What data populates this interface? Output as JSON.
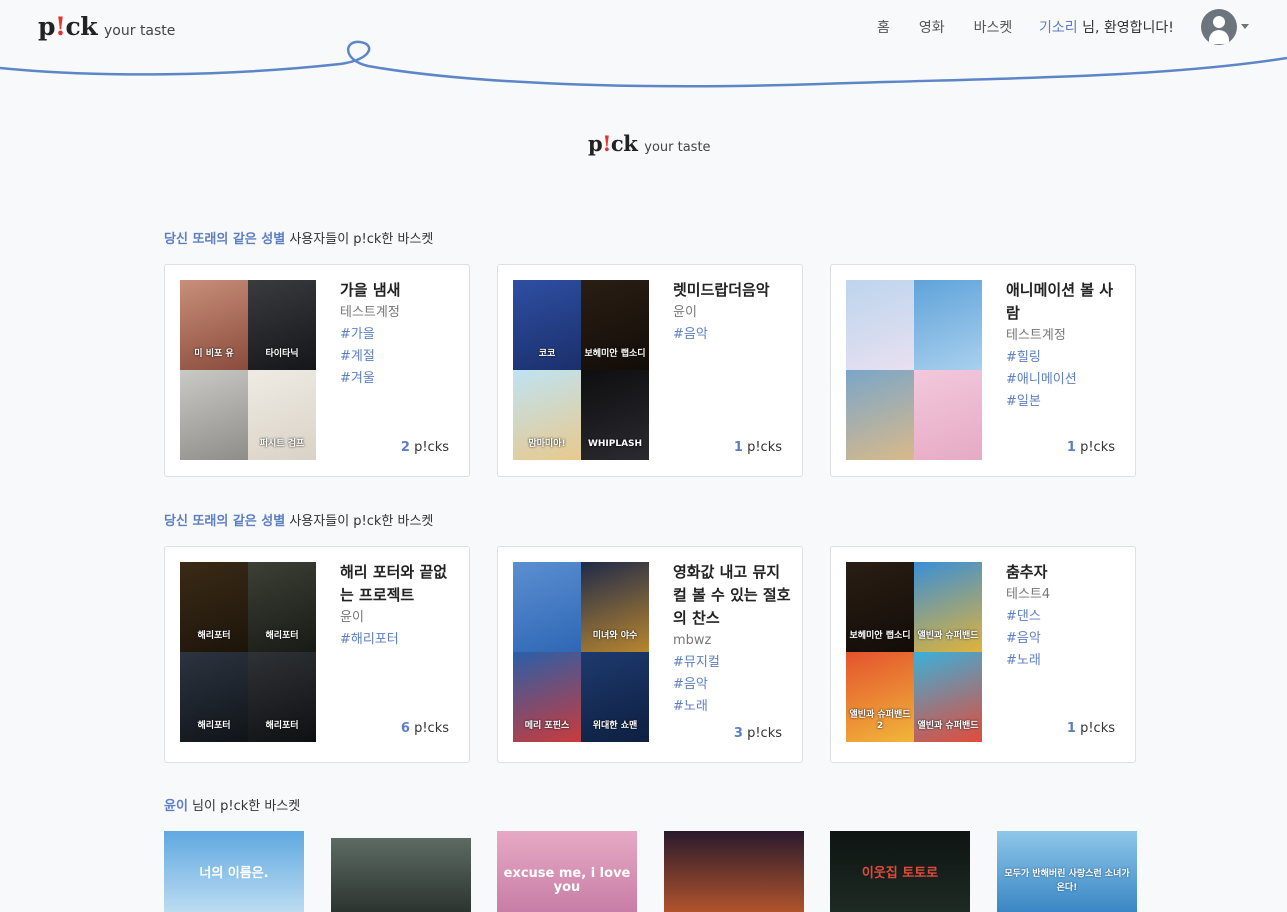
{
  "brand": {
    "mark_p": "p",
    "mark_bang": "!",
    "mark_ck": "ck",
    "tagline": "your taste"
  },
  "nav": {
    "links": [
      "홈",
      "영화",
      "바스켓"
    ],
    "username": "기소리",
    "welcome_suffix": " 님, 환영합니다!"
  },
  "hero": {
    "mark_p": "p",
    "mark_bang": "!",
    "mark_ck": "ck",
    "tagline": "your taste"
  },
  "section1": {
    "highlight": "당신 또래의 같은 성별",
    "rest": " 사용자들이 p!ck한 바스켓"
  },
  "section2": {
    "highlight": "당신 또래의 같은 성별",
    "rest": " 사용자들이 p!ck한 바스켓"
  },
  "section3": {
    "highlight": "윤이",
    "rest": " 님이 p!ck한 바스켓"
  },
  "picks_label": " p!cks",
  "row1": [
    {
      "title": "가을 냄새",
      "author": "테스트계정",
      "tags": [
        "#가을",
        "#계절",
        "#겨울"
      ],
      "picks": "2",
      "posters": [
        {
          "caption": "미 비포 유",
          "colors": [
            "#c98f7a",
            "#8a4b3c"
          ]
        },
        {
          "caption": "타이타닉",
          "colors": [
            "#3a3b3f",
            "#15161a"
          ]
        },
        {
          "caption": "",
          "colors": [
            "#c9c9c6",
            "#8f8d88"
          ]
        },
        {
          "caption": "퍼시트 검프",
          "colors": [
            "#efebe4",
            "#d9d2c6"
          ]
        }
      ]
    },
    {
      "title": "렛미드랍더음악",
      "author": "윤이",
      "tags": [
        "#음악"
      ],
      "picks": "1",
      "posters": [
        {
          "caption": "코코",
          "colors": [
            "#2e4fa3",
            "#1b2f6b"
          ]
        },
        {
          "caption": "보헤미안 랩소디",
          "colors": [
            "#2a1e14",
            "#120c08"
          ]
        },
        {
          "caption": "맘마미아!",
          "colors": [
            "#bfe3f3",
            "#e8c98c"
          ]
        },
        {
          "caption": "WHIPLASH",
          "colors": [
            "#0e0e10",
            "#2a2a30"
          ]
        }
      ]
    },
    {
      "title": "애니메이션 볼 사람",
      "author": "테스트계정",
      "tags": [
        "#힐링",
        "#애니메이션",
        "#일본"
      ],
      "picks": "1",
      "posters": [
        {
          "caption": "",
          "colors": [
            "#bcd5ee",
            "#e8e0f0"
          ]
        },
        {
          "caption": "",
          "colors": [
            "#5fa3d9",
            "#a9d0ee"
          ]
        },
        {
          "caption": "",
          "colors": [
            "#7aa6c9",
            "#d9b98a"
          ]
        },
        {
          "caption": "",
          "colors": [
            "#f2c8dc",
            "#e6aac4"
          ]
        }
      ]
    }
  ],
  "row2": [
    {
      "title": "해리 포터와 끝없는 프로젝트",
      "author": "윤이",
      "tags": [
        "#해리포터"
      ],
      "picks": "6",
      "posters": [
        {
          "caption": "해리포터",
          "colors": [
            "#3b2b16",
            "#1c140a"
          ]
        },
        {
          "caption": "해리포터",
          "colors": [
            "#3d4036",
            "#181a15"
          ]
        },
        {
          "caption": "해리포터",
          "colors": [
            "#2c3440",
            "#101419"
          ]
        },
        {
          "caption": "해리포터",
          "colors": [
            "#2f3236",
            "#0f1012"
          ]
        }
      ]
    },
    {
      "title": "영화값 내고 뮤지컬 볼 수 있는 절호의 찬스",
      "author": "mbwz",
      "tags": [
        "#뮤지컬",
        "#음악",
        "#노래"
      ],
      "picks": "3",
      "posters": [
        {
          "caption": "",
          "colors": [
            "#5b8fd1",
            "#2f67b5"
          ]
        },
        {
          "caption": "미녀와 야수",
          "colors": [
            "#1f2a4a",
            "#b8862e"
          ]
        },
        {
          "caption": "메리 포핀스",
          "colors": [
            "#2a5fa8",
            "#c93b3b"
          ]
        },
        {
          "caption": "위대한 쇼맨",
          "colors": [
            "#1d3a6e",
            "#0e1f40"
          ]
        }
      ]
    },
    {
      "title": "춤추자",
      "author": "테스트4",
      "tags": [
        "#댄스",
        "#음악",
        "#노래"
      ],
      "picks": "1",
      "posters": [
        {
          "caption": "보헤미안 랩소디",
          "colors": [
            "#2a1e14",
            "#120c08"
          ]
        },
        {
          "caption": "앨빈과 슈퍼밴드",
          "colors": [
            "#3a8fd6",
            "#e0b33a"
          ]
        },
        {
          "caption": "앨빈과 슈퍼밴드 2",
          "colors": [
            "#e4532e",
            "#f1b63a"
          ]
        },
        {
          "caption": "앨빈과 슈퍼밴드",
          "colors": [
            "#3bb0d9",
            "#e24b3a"
          ]
        }
      ]
    }
  ],
  "bottom_posters": [
    {
      "caption": "너의 이름은.",
      "colors": [
        "#5fa8e0",
        "#bcdcf2"
      ]
    },
    {
      "caption": "",
      "colors": [
        "#5d6b63",
        "#2c3430"
      ]
    },
    {
      "caption": "excuse me, i love you",
      "colors": [
        "#e6a9c4",
        "#c87ea6"
      ]
    },
    {
      "caption": "",
      "colors": [
        "#2a1a2e",
        "#b0542b"
      ]
    },
    {
      "caption": "이웃집 토토로",
      "colors": [
        "#0e1412",
        "#1e2a24"
      ]
    },
    {
      "caption": "모두가 반해버린 사랑스런 소녀가 온다!",
      "colors": [
        "#8ec7ea",
        "#3a86c4"
      ]
    }
  ],
  "colors": {
    "accent": "#5c7fc4",
    "wave": "#5c86c8",
    "bang": "#e3342f"
  }
}
